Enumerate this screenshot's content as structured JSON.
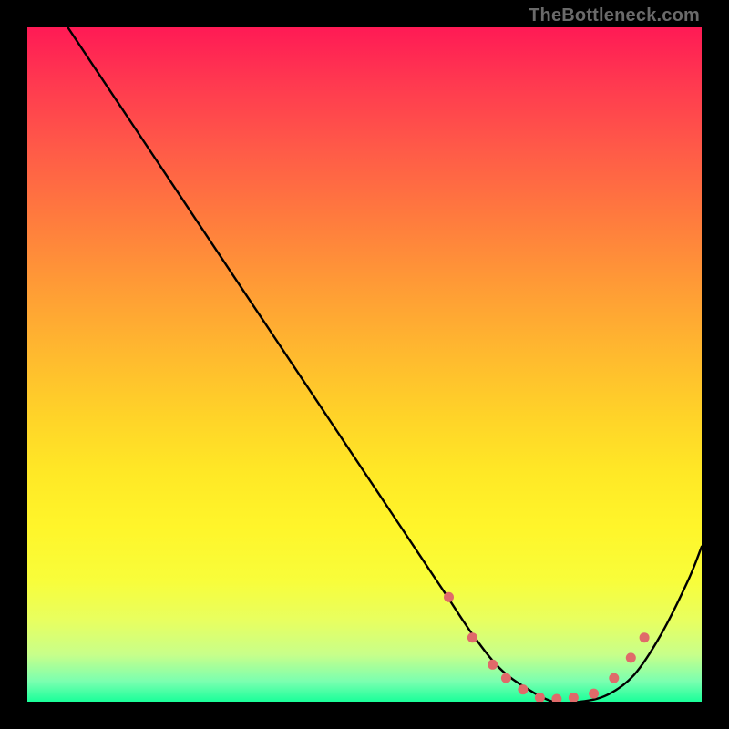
{
  "watermark": "TheBottleneck.com",
  "chart_data": {
    "type": "line",
    "title": "",
    "xlabel": "",
    "ylabel": "",
    "xlim": [
      0,
      100
    ],
    "ylim": [
      0,
      100
    ],
    "grid": false,
    "legend": false,
    "series": [
      {
        "name": "bottleneck-curve",
        "color": "#000000",
        "x": [
          6,
          10,
          16,
          22,
          28,
          34,
          40,
          46,
          52,
          58,
          62,
          66,
          70,
          74,
          78,
          82,
          86,
          90,
          94,
          98,
          100
        ],
        "y": [
          100,
          94,
          85,
          76,
          67,
          58,
          49,
          40,
          31,
          22,
          16,
          10,
          5,
          2,
          0,
          0,
          1,
          4,
          10,
          18,
          23
        ]
      }
    ],
    "markers": {
      "name": "highlight-dots",
      "color": "#e06a6a",
      "x": [
        62.5,
        66,
        69,
        71,
        73.5,
        76,
        78.5,
        81,
        84,
        87,
        89.5,
        91.5
      ],
      "y": [
        15.5,
        9.5,
        5.5,
        3.5,
        1.8,
        0.6,
        0.4,
        0.6,
        1.2,
        3.5,
        6.5,
        9.5
      ]
    }
  }
}
